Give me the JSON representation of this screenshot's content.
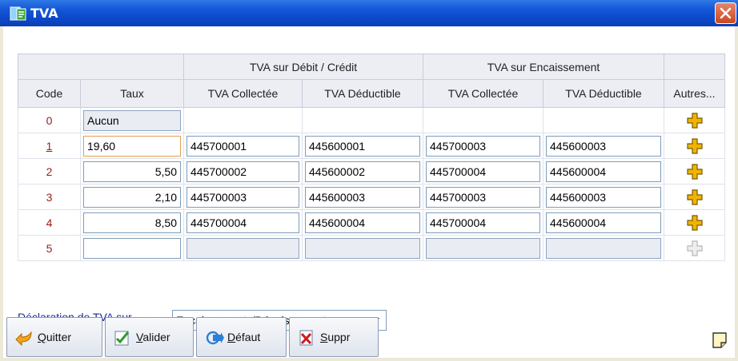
{
  "window": {
    "title": "TVA"
  },
  "table": {
    "group_headers": [
      "TVA sur Débit / Crédit",
      "TVA sur Encaissement"
    ],
    "columns": [
      "Code",
      "Taux",
      "TVA Collectée",
      "TVA Déductible",
      "TVA Collectée",
      "TVA Déductible",
      "Autres..."
    ],
    "rows": [
      {
        "code": "0",
        "taux": "Aucun",
        "debit_collectee": "",
        "debit_deductible": "",
        "enc_collectee": "",
        "enc_deductible": ""
      },
      {
        "code": "1",
        "taux": "19,60",
        "debit_collectee": "445700001",
        "debit_deductible": "445600001",
        "enc_collectee": "445700003",
        "enc_deductible": "445600003"
      },
      {
        "code": "2",
        "taux": "5,50",
        "debit_collectee": "445700002",
        "debit_deductible": "445600002",
        "enc_collectee": "445700004",
        "enc_deductible": "445600004"
      },
      {
        "code": "3",
        "taux": "2,10",
        "debit_collectee": "445700003",
        "debit_deductible": "445600003",
        "enc_collectee": "445700003",
        "enc_deductible": "445600003"
      },
      {
        "code": "4",
        "taux": "8,50",
        "debit_collectee": "445700004",
        "debit_deductible": "445600004",
        "enc_collectee": "445700004",
        "enc_deductible": "445600004"
      },
      {
        "code": "5",
        "taux": "",
        "debit_collectee": "",
        "debit_deductible": "",
        "enc_collectee": "",
        "enc_deductible": ""
      }
    ]
  },
  "declaration": {
    "label": "Déclaration de TVA sur",
    "selected": "Encaissements/Décaissements"
  },
  "buttons": {
    "quitter": {
      "key": "Q",
      "rest": "uitter"
    },
    "valider": {
      "key": "V",
      "rest": "alider"
    },
    "defaut": {
      "key": "D",
      "rest": "éfaut"
    },
    "suppr": {
      "key": "S",
      "rest": "uppr"
    }
  },
  "colors": {
    "titlebar": "#0c48c9",
    "code_text": "#9a1d1d",
    "label_text": "#1a2f8c",
    "plus_icon": "#f0b400"
  }
}
